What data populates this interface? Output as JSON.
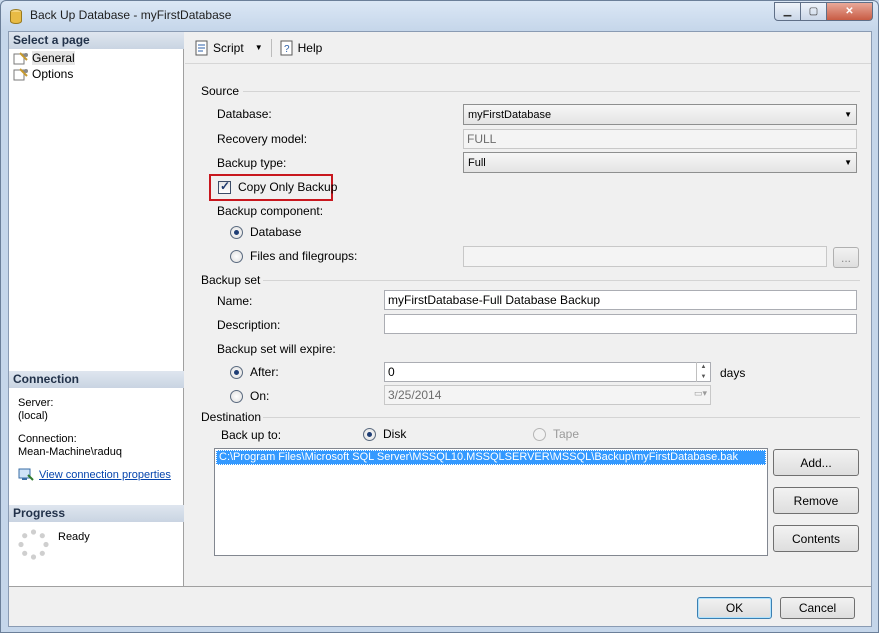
{
  "window": {
    "title": "Back Up Database - myFirstDatabase"
  },
  "left_pane": {
    "select_page_header": "Select a page",
    "pages": [
      {
        "label": "General"
      },
      {
        "label": "Options"
      }
    ],
    "connection_header": "Connection",
    "server_label": "Server:",
    "server_value": "(local)",
    "connection_label": "Connection:",
    "connection_value": "Mean-Machine\\raduq",
    "view_connection_link": "View connection properties",
    "progress_header": "Progress",
    "progress_status": "Ready"
  },
  "toolbar": {
    "script_label": "Script",
    "help_label": "Help"
  },
  "source": {
    "group_label": "Source",
    "database_label": "Database:",
    "database_value": "myFirstDatabase",
    "recovery_model_label": "Recovery model:",
    "recovery_model_value": "FULL",
    "backup_type_label": "Backup type:",
    "backup_type_value": "Full",
    "copy_only_label": "Copy Only Backup",
    "copy_only_checked": true,
    "component_label": "Backup component:",
    "component_database": "Database",
    "component_files": "Files and filegroups:",
    "browse_label": "..."
  },
  "backup_set": {
    "group_label": "Backup set",
    "name_label": "Name:",
    "name_value": "myFirstDatabase-Full Database Backup",
    "description_label": "Description:",
    "description_value": "",
    "expire_label": "Backup set will expire:",
    "after_label": "After:",
    "after_value": "0",
    "days_label": "days",
    "on_label": "On:",
    "on_value": "3/25/2014"
  },
  "destination": {
    "group_label": "Destination",
    "back_up_to_label": "Back up to:",
    "disk_label": "Disk",
    "tape_label": "Tape",
    "paths": [
      "C:\\Program Files\\Microsoft SQL Server\\MSSQL10.MSSQLSERVER\\MSSQL\\Backup\\myFirstDatabase.bak"
    ],
    "add_label": "Add...",
    "remove_label": "Remove",
    "contents_label": "Contents"
  },
  "footer": {
    "ok_label": "OK",
    "cancel_label": "Cancel"
  },
  "colors": {
    "highlight_border": "#c8171e",
    "selection": "#3399ff",
    "link": "#0645ad"
  }
}
